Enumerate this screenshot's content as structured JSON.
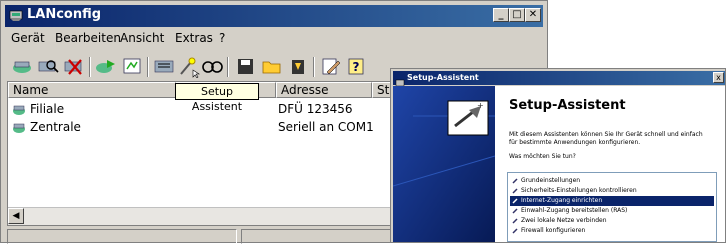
{
  "window": {
    "title": "LANconfig",
    "controls": {
      "minimize": "_",
      "maximize": "□",
      "close": "✕"
    }
  },
  "menu": [
    "Gerät",
    "Bearbeiten",
    "Ansicht",
    "Extras",
    "?"
  ],
  "toolbar_icons": [
    "connect-icon",
    "search-icon",
    "delete-icon",
    "network-icon",
    "configure-icon",
    "settings-icon",
    "setup-wizard-icon",
    "monitor-icon",
    "save-icon",
    "open-folder-icon",
    "firmware-icon",
    "edit-icon",
    "help-icon"
  ],
  "tooltip": "Setup Assistent",
  "list": {
    "columns": [
      "Name",
      "",
      "Adresse",
      "St"
    ],
    "rows": [
      {
        "name": "Filiale",
        "address": "DFÜ 123456"
      },
      {
        "name": "Zentrale",
        "address": "Seriell an COM1"
      }
    ]
  },
  "wizard": {
    "title": "Setup-Assistent",
    "close": "x",
    "heading": "Setup-Assistent",
    "description": "Mit diesem Assistenten können Sie Ihr Gerät schnell und einfach für bestimmte Anwendungen konfigurieren.",
    "question": "Was möchten Sie tun?",
    "options": [
      "Grundeinstellungen",
      "Sicherheits-Einstellungen kontrollieren",
      "Internet-Zugang einrichten",
      "Einwahl-Zugang bereitstellen (RAS)",
      "Zwei lokale Netze verbinden",
      "Firewall konfigurieren"
    ],
    "selected_index": 2
  },
  "colors": {
    "titlebar": "#0a246a",
    "face": "#d4d0c8",
    "tooltip_bg": "#ffffe1",
    "wizard_panel": "#0c2a7a"
  }
}
